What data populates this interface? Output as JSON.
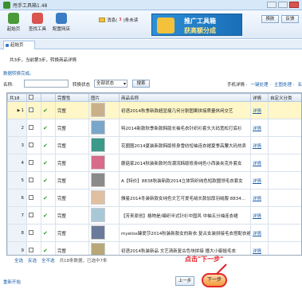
{
  "window": {
    "title": "甩手工具箱1.48",
    "colors": {
      "chrome": "#d7e8f8",
      "accent": "#1b5fa8",
      "highlight": "#e0202a"
    }
  },
  "toolbar": {
    "items": [
      {
        "label": "起始页",
        "icon": "home-icon"
      },
      {
        "label": "查找工具",
        "icon": "toolbox-icon"
      },
      {
        "label": "配置网店",
        "icon": "store-icon"
      }
    ],
    "messages_prefix": "消息(",
    "messages_count": "3",
    "messages_suffix": ")条未读",
    "promo_line1": "推广工具箱",
    "promo_line2": "获高额分成",
    "skin_label": "换肤",
    "feedback_label": "反馈"
  },
  "tab": {
    "label": "起始页"
  },
  "step_text": "共3步，当前第3步，转换商品详情",
  "status_text": "数据转换完成。",
  "filter": {
    "name_label": "名称:",
    "name_value": "",
    "status_label": "转换状态",
    "status_value": "全部状态",
    "search_label": "搜索",
    "right_links": [
      "手机详情 ·",
      "一键处理 ·",
      "主图处理 ·",
      "名"
    ]
  },
  "table": {
    "columns": [
      "共18",
      "",
      "",
      "完整性",
      "图片",
      "商品名称",
      "详情",
      "自定义分类"
    ],
    "rows": [
      {
        "num": "1",
        "status": "完整",
        "name": "初语2014秋季新款超显瘦几何分割图案拼接质量休闲交艺",
        "detail": "详情",
        "thumb_color": "#c9b08a"
      },
      {
        "num": "2",
        "status": "完整",
        "name": "特2014新款秋季新款韩版长袖毛衣针织衫套头大码宽松打底衫",
        "detail": "详情",
        "thumb_color": "#7aa6c9"
      },
      {
        "num": "3",
        "status": "完整",
        "name": "花圈圈2014夏装新款韩版修身雪纺短袖连衣裙夏季高腰大码热卖",
        "detail": "详情",
        "thumb_color": "#3c9a8a"
      },
      {
        "num": "4",
        "status": "完整",
        "name": "蘑菇家2014秋装新款时尚潮流韩版修身纯色小西装夹克外套女",
        "detail": "详情",
        "thumb_color": "#d86a8a"
      },
      {
        "num": "5",
        "status": "完整",
        "name": "A【特价】8838秋装新款2014立体钩织纯色短款圆领毛衣套女",
        "detail": "详情",
        "thumb_color": "#8a8a8a"
      },
      {
        "num": "6",
        "status": "完整",
        "name": "雅曼2014冬装新款女纯色文艺可爱毛绒长款加厚羽绒服 8834...",
        "detail": "详情",
        "thumb_color": "#e0c0a0"
      },
      {
        "num": "7",
        "status": "完整",
        "name": "【芳来原创】格物是/编织半式针衫中国风 中袖五分袖连衣裙",
        "detail": "详情",
        "thumb_color": "#a8c8d8"
      },
      {
        "num": "8",
        "status": "完整",
        "name": "myeliss臻爱莎2014秋装新款女的新衣 复古女装拼接毛衣搭配衣裙",
        "detail": "详情",
        "thumb_color": "#6a7a9a"
      },
      {
        "num": "9",
        "status": "完整",
        "name": "初语2014秋装新品 文艺清新复古色块拼接 撞大小御姐毛衣",
        "detail": "详情",
        "thumb_color": "#b8a878"
      }
    ]
  },
  "bottom": {
    "select_all": "全选",
    "invert": "反选",
    "select_none": "全不选",
    "stats": "共18条数据，已选中7条"
  },
  "hint_text": "点击\"下一步\"",
  "buttons": {
    "reset": "重新开始",
    "prev": "上一步",
    "next": "下一步"
  }
}
